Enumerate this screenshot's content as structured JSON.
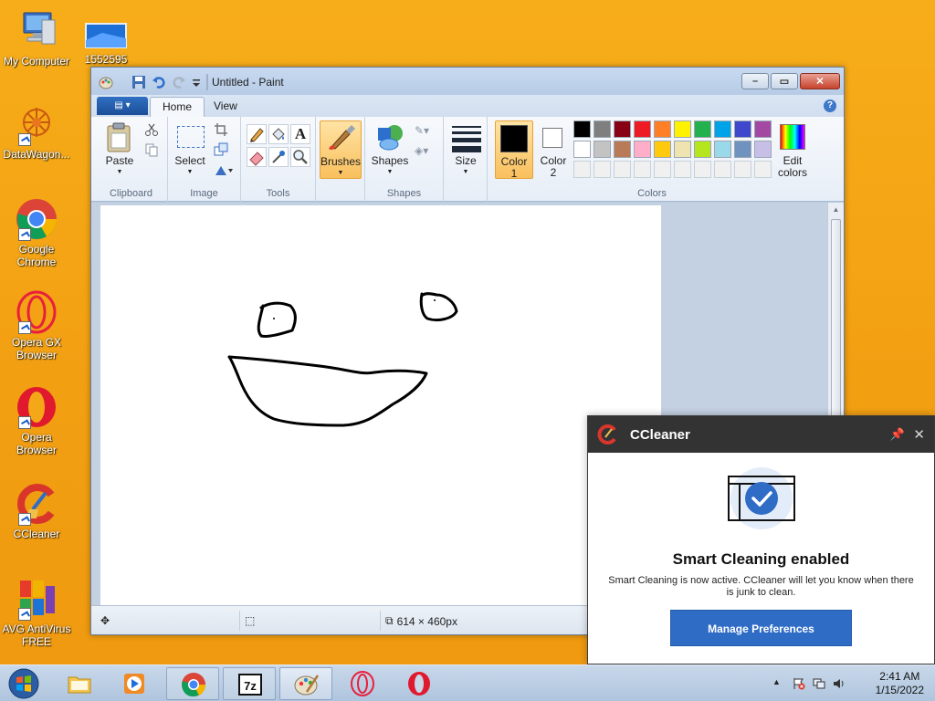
{
  "desktop": {
    "icons": [
      {
        "label": "My Computer",
        "icon": "computer-icon"
      },
      {
        "label": "1552595",
        "icon": "image-file-icon"
      },
      {
        "label": "DataWagon...",
        "icon": "datawagon-icon"
      },
      {
        "label": "Google Chrome",
        "icon": "chrome-icon"
      },
      {
        "label": "Opera GX Browser",
        "icon": "opera-gx-icon"
      },
      {
        "label": "Opera Browser",
        "icon": "opera-icon"
      },
      {
        "label": "CCleaner",
        "icon": "ccleaner-icon"
      },
      {
        "label": "AVG AntiVirus FREE",
        "icon": "avg-icon"
      }
    ]
  },
  "paint": {
    "title": "Untitled - Paint",
    "tabs": [
      "Home",
      "View"
    ],
    "active_tab": "Home",
    "ribbon": {
      "clipboard": {
        "label": "Clipboard",
        "paste": "Paste"
      },
      "image": {
        "label": "Image",
        "select": "Select"
      },
      "tools": {
        "label": "Tools"
      },
      "brushes": {
        "label": "Brushes"
      },
      "shapes": {
        "label": "Shapes",
        "button": "Shapes"
      },
      "size": {
        "label": "Size"
      },
      "color1": {
        "label": "Color",
        "num": "1",
        "value": "#000000"
      },
      "color2": {
        "label": "Color",
        "num": "2",
        "value": "#ffffff"
      },
      "colors": {
        "label": "Colors",
        "edit": "Edit",
        "edit2": "colors"
      },
      "palette_row1": [
        "#000000",
        "#7f7f7f",
        "#880015",
        "#ed1c24",
        "#ff7f27",
        "#fff200",
        "#22b14c",
        "#00a2e8",
        "#3f48cc",
        "#a349a4"
      ],
      "palette_row2": [
        "#ffffff",
        "#c3c3c3",
        "#b97a57",
        "#ffaec9",
        "#ffc90e",
        "#efe4b0",
        "#b5e61d",
        "#99d9ea",
        "#7092be",
        "#c8bfe7"
      ],
      "palette_row3": [
        "#f0f0f0",
        "#f0f0f0",
        "#f0f0f0",
        "#f0f0f0",
        "#f0f0f0",
        "#f0f0f0",
        "#f0f0f0",
        "#f0f0f0",
        "#f0f0f0",
        "#f0f0f0"
      ]
    },
    "status": {
      "canvas_size": "614 × 460px"
    }
  },
  "ccleaner": {
    "title": "CCleaner",
    "heading": "Smart Cleaning enabled",
    "body": "Smart Cleaning is now active. CCleaner will let you know when there is junk to clean.",
    "button": "Manage Preferences"
  },
  "taskbar": {
    "apps": [
      {
        "name": "file-explorer",
        "icon": "folder-icon"
      },
      {
        "name": "media-player",
        "icon": "media-player-icon"
      },
      {
        "name": "chrome",
        "icon": "chrome-icon"
      },
      {
        "name": "7zip",
        "icon": "7zip-icon"
      },
      {
        "name": "paint",
        "icon": "paint-icon"
      },
      {
        "name": "opera-gx",
        "icon": "opera-gx-icon"
      },
      {
        "name": "opera",
        "icon": "opera-icon"
      }
    ],
    "clock": {
      "time": "2:41 AM",
      "date": "1/15/2022"
    }
  }
}
